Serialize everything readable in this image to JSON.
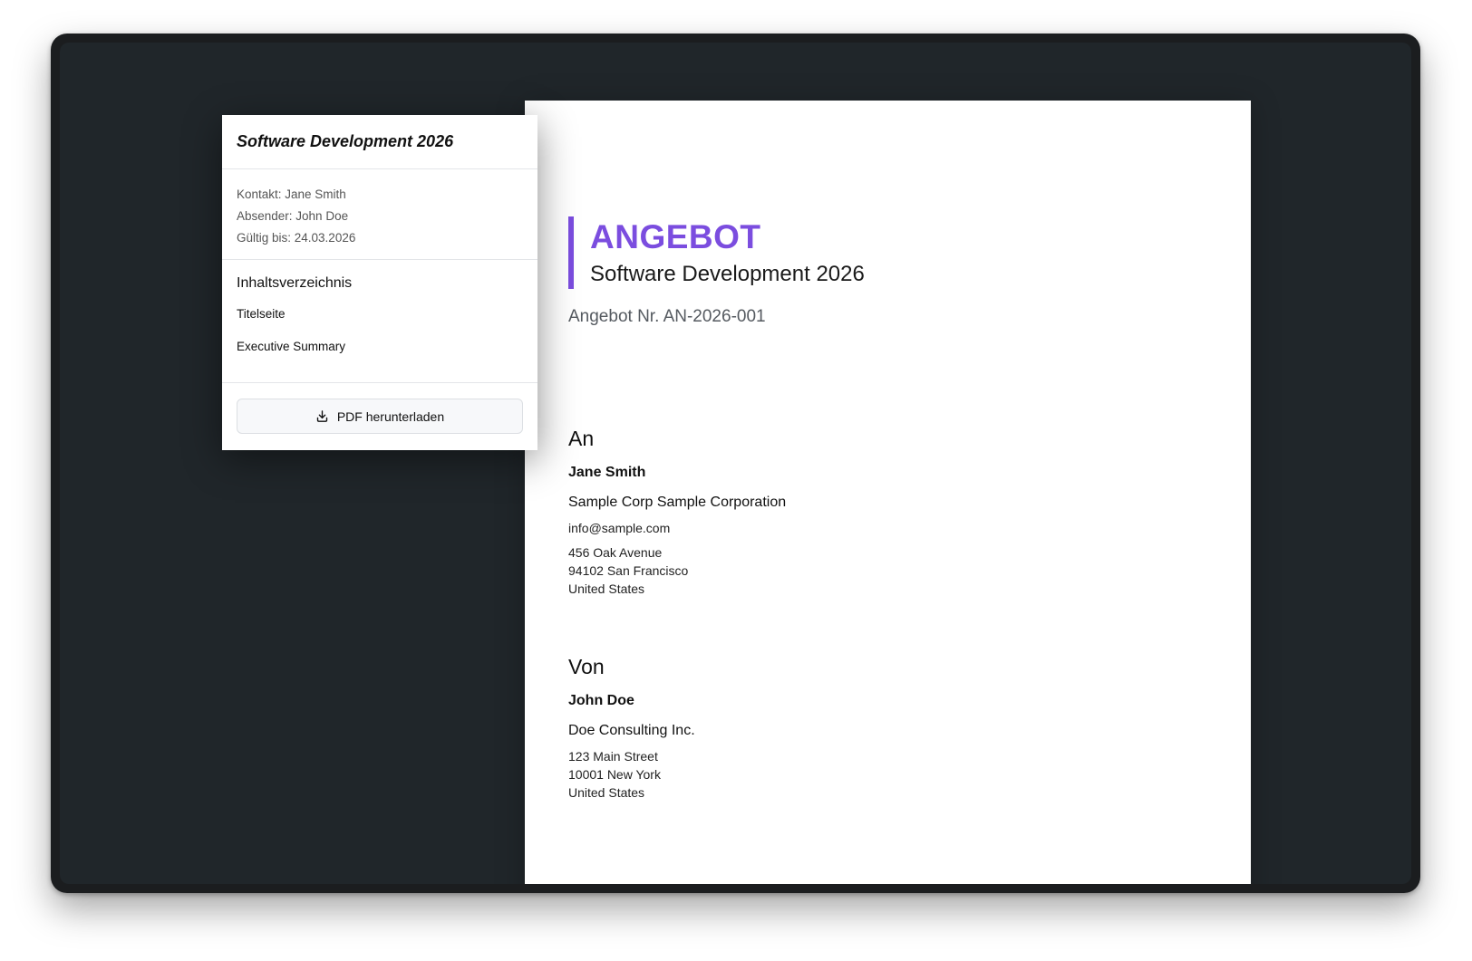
{
  "panel": {
    "title": "Software Development 2026",
    "meta": {
      "contact": "Kontakt: Jane Smith",
      "sender": "Absender: John Doe",
      "valid_until": "Gültig bis: 24.03.2026"
    },
    "toc": {
      "heading": "Inhaltsverzeichnis",
      "items": [
        "Titelseite",
        "Executive Summary"
      ]
    },
    "download_button": {
      "label": "PDF herunterladen",
      "icon": "download-icon"
    }
  },
  "document": {
    "type_label": "ANGEBOT",
    "title": "Software Development 2026",
    "offer_number": "Angebot Nr. AN-2026-001",
    "accent_color": "#7b4ddf",
    "recipient": {
      "heading": "An",
      "name": "Jane Smith",
      "company": "Sample Corp Sample Corporation",
      "email": "info@sample.com",
      "address": [
        "456 Oak Avenue",
        "94102 San Francisco",
        "United States"
      ]
    },
    "sender": {
      "heading": "Von",
      "name": "John Doe",
      "company": "Doe Consulting Inc.",
      "address": [
        "123 Main Street",
        "10001 New York",
        "United States"
      ]
    }
  }
}
